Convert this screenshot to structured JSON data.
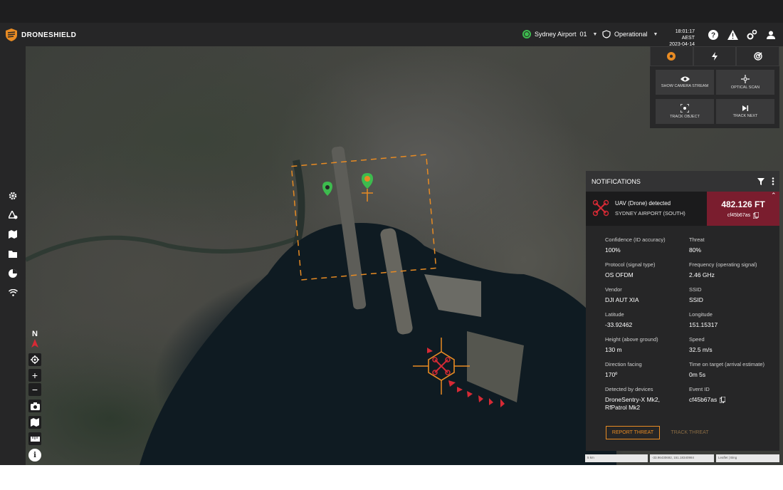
{
  "brand": {
    "name_a": "DRONE",
    "name_b": "SHIELD",
    "accent": "#e88b23"
  },
  "header": {
    "site": "Sydney Airport",
    "site_num": "01",
    "mode": "Operational",
    "time": "18:01:17 AEST",
    "date": "2023-04-14",
    "icons": [
      "help-icon",
      "warning-icon",
      "settings-icon",
      "user-icon"
    ]
  },
  "sidebar": {
    "icons": [
      "gear-icon",
      "map-layers-icon",
      "map-icon",
      "folder-icon",
      "chart-icon",
      "wifi-icon"
    ]
  },
  "map_controls": {
    "north": "N",
    "icons": [
      "compass-icon",
      "locate-icon",
      "zoom-in-icon",
      "zoom-out-icon",
      "camera-icon",
      "map-icon",
      "ruler-icon",
      "info-icon"
    ]
  },
  "camera_panel": {
    "tabs": [
      "camera-tab",
      "bolt-tab",
      "radar-tab"
    ],
    "buttons": [
      {
        "label": "Show Camera Stream",
        "icon": "eye-icon"
      },
      {
        "label": "Optical Scan",
        "icon": "scan-icon"
      },
      {
        "label": "Track Object",
        "icon": "target-icon"
      },
      {
        "label": "Track Next",
        "icon": "skip-icon"
      }
    ]
  },
  "notifications": {
    "title": "NOTIFICATIONS",
    "alert": {
      "title": "UAV (Drone) detected",
      "location": "SYDNEY AIRPORT (SOUTH)",
      "altitude": "482.126 FT",
      "id": "cf45b67as"
    },
    "fields": [
      {
        "label": "Confidence (ID accuracy)",
        "value": "100%"
      },
      {
        "label": "Threat",
        "value": "80%"
      },
      {
        "label": "Protocol (signal type)",
        "value": "OS OFDM"
      },
      {
        "label": "Frequency (operating signal)",
        "value": "2.46 GHz"
      },
      {
        "label": "Vendor",
        "value": "DJI AUT XIA"
      },
      {
        "label": "SSID",
        "value": "SSID"
      },
      {
        "label": "Latitude",
        "value": "-33.92462"
      },
      {
        "label": "Longitude",
        "value": "151.15317"
      },
      {
        "label": "Height (above ground)",
        "value": "130 m"
      },
      {
        "label": "Speed",
        "value": "32.5 m/s"
      },
      {
        "label": "Direction facing",
        "value": "170º"
      },
      {
        "label": "Time on target (arrival estimate)",
        "value": "0m 5s"
      },
      {
        "label": "Detected by devices",
        "value": "DroneSentry-X Mk2, RfPatrol Mk2"
      },
      {
        "label": "Event ID",
        "value": "cf45b67as"
      }
    ],
    "report_btn": "REPORT THREAT",
    "track_btn": "TRACK THREAT"
  },
  "footer": {
    "scale": "5 km",
    "coords": "-33.96430692, 151.18340984",
    "attribution": "Leaflet | Bing"
  },
  "colors": {
    "panel": "#262627",
    "threat": "#7a1d2e",
    "drone_red": "#d62a35",
    "zone_orange": "#e88b23",
    "sensor_green": "#3dbb4e"
  }
}
